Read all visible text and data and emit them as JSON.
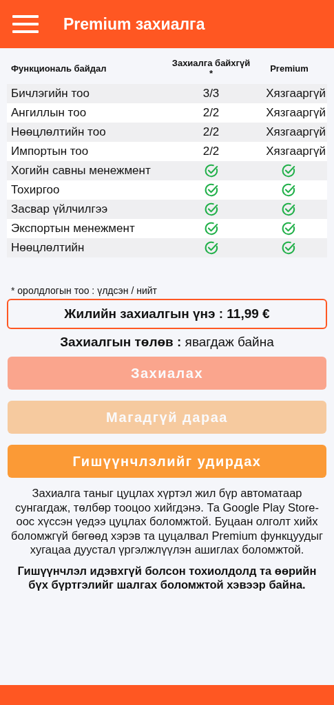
{
  "app_bar": {
    "title": "Premium захиалга"
  },
  "table": {
    "columns": [
      "Функциональ байдал",
      "Захиалга байхгүй *",
      "Premium"
    ],
    "rows": [
      {
        "feature": "Бичлэгийн тоо",
        "free": {
          "kind": "text",
          "text": "3/3"
        },
        "premium": {
          "kind": "text",
          "text": "Хязгааргүй"
        }
      },
      {
        "feature": "Ангиллын тоо",
        "free": {
          "kind": "text",
          "text": "2/2"
        },
        "premium": {
          "kind": "text",
          "text": "Хязгааргүй"
        }
      },
      {
        "feature": "Нөөцлөлтийн тоо",
        "free": {
          "kind": "text",
          "text": "2/2"
        },
        "premium": {
          "kind": "text",
          "text": "Хязгааргүй"
        }
      },
      {
        "feature": "Импортын тоо",
        "free": {
          "kind": "text",
          "text": "2/2"
        },
        "premium": {
          "kind": "text",
          "text": "Хязгааргүй"
        }
      },
      {
        "feature": "Хогийн савны менежмент",
        "free": {
          "kind": "check"
        },
        "premium": {
          "kind": "check"
        }
      },
      {
        "feature": "Тохиргоо",
        "free": {
          "kind": "check"
        },
        "premium": {
          "kind": "check"
        }
      },
      {
        "feature": "Засвар үйлчилгээ",
        "free": {
          "kind": "check"
        },
        "premium": {
          "kind": "check"
        }
      },
      {
        "feature": "Экспортын менежмент",
        "free": {
          "kind": "check"
        },
        "premium": {
          "kind": "check"
        }
      },
      {
        "feature": "Нөөцлөлтийн",
        "free": {
          "kind": "check"
        },
        "premium": {
          "kind": "check"
        }
      }
    ]
  },
  "footnote": "* оролдлогын тоо : үлдсэн / нийт",
  "price": "Жилийн захиалгын үнэ : 11,99 €",
  "status": "**Захиалгын төлөв :** явагдаж байна",
  "buttons": [
    {
      "label": "Захиалах",
      "kind": "subscribe",
      "disabled": true
    },
    {
      "label": "Магадгүй дараа",
      "kind": "later",
      "disabled": true
    },
    {
      "label": "Гишүүнчлэлийг удирдах",
      "kind": "manage",
      "disabled": false
    }
  ],
  "notice": "Захиалга таныг цуцлах хүртэл жил бүр автоматаар сунгагдаж, төлбөр тооцоо хийгдэнэ. Та Google Play Store-оос хүссэн үедээ цуцлах боломжтой. Буцаан олголт хийх боломжгүй бөгөөд хэрэв та цуцалвал Premium функцуудыг хугацаа дуустал үргэлжлүүлэн ашиглах боломжтой.",
  "notice_bold": "Гишүүнчлэл идэвхгүй болсон тохиолдолд та өөрийн бүх бүртгэлийг шалгах боломжтой хэвээр байна."
}
